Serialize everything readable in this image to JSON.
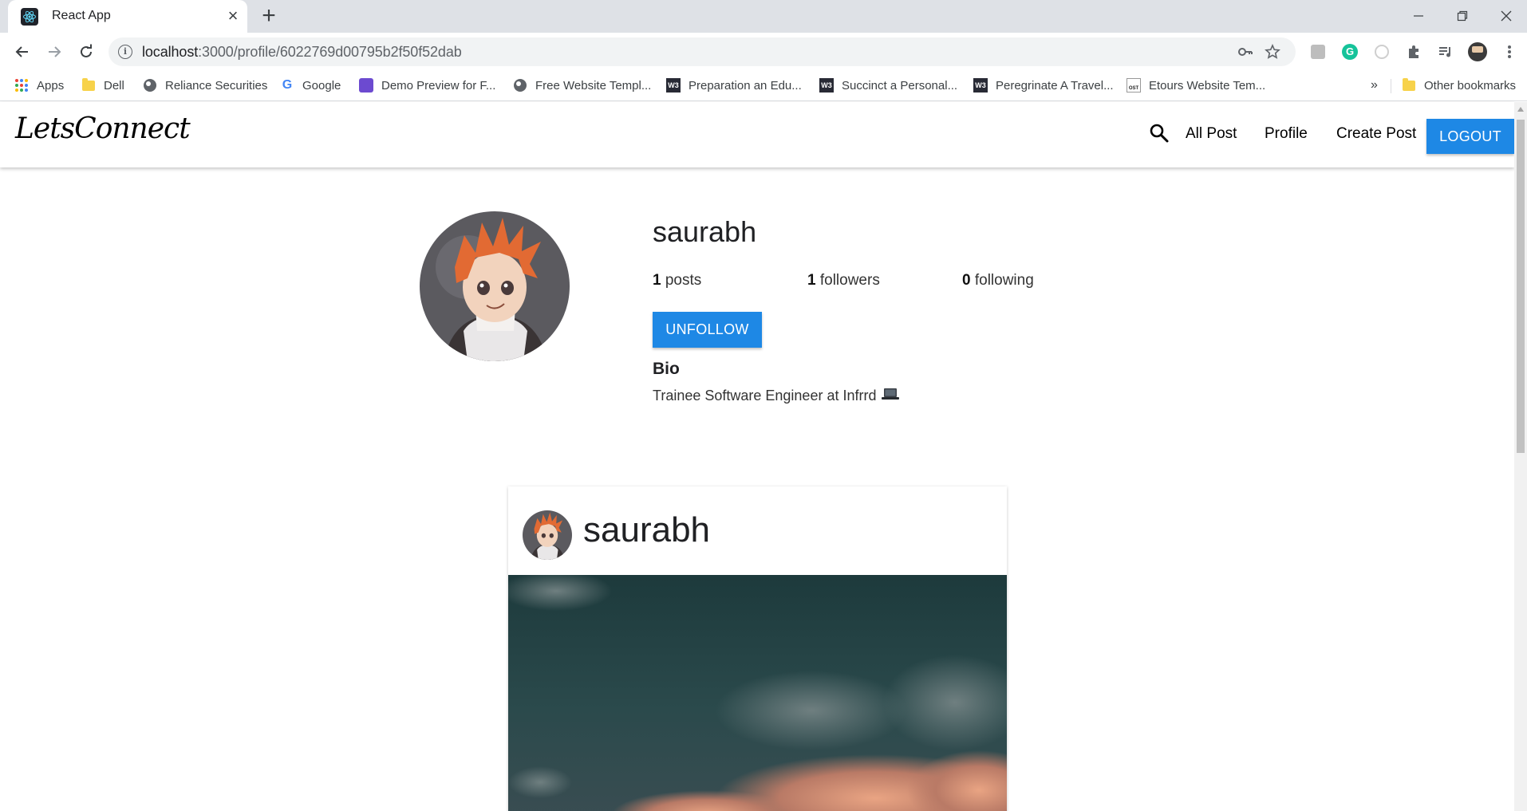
{
  "browser": {
    "tab_title": "React App",
    "url_host": "localhost",
    "url_rest": ":3000/profile/6022769d00795b2f50f52dab"
  },
  "bookmarks": [
    {
      "label": "Apps",
      "icon": "apps-grid-icon"
    },
    {
      "label": "Dell",
      "icon": "folder-icon"
    },
    {
      "label": "Reliance Securities",
      "icon": "globe-icon"
    },
    {
      "label": "Google",
      "icon": "google-icon"
    },
    {
      "label": "Demo Preview for F...",
      "icon": "demo-icon"
    },
    {
      "label": "Free Website Templ...",
      "icon": "globe-icon"
    },
    {
      "label": "Preparation an Edu...",
      "icon": "w3-icon"
    },
    {
      "label": "Succinct a Personal...",
      "icon": "w3-icon"
    },
    {
      "label": "Peregrinate A Travel...",
      "icon": "w3-icon"
    },
    {
      "label": "Etours Website Tem...",
      "icon": "ost-icon"
    }
  ],
  "bookmarks_more": "»",
  "other_bookmarks": "Other bookmarks",
  "app": {
    "logo": "LetsConnect",
    "nav": {
      "all_post": "All Post",
      "profile": "Profile",
      "create_post": "Create Post",
      "logout": "LOGOUT"
    }
  },
  "profile": {
    "username": "saurabh",
    "posts_count": "1",
    "posts_label": "posts",
    "followers_count": "1",
    "followers_label": "followers",
    "following_count": "0",
    "following_label": "following",
    "unfollow_label": "UNFOLLOW",
    "bio_title": "Bio",
    "bio_text": "Trainee Software Engineer at Infrrd"
  },
  "post": {
    "username": "saurabh"
  },
  "colors": {
    "primary_button": "#1e88e5",
    "tab_strip": "#dee1e6"
  }
}
